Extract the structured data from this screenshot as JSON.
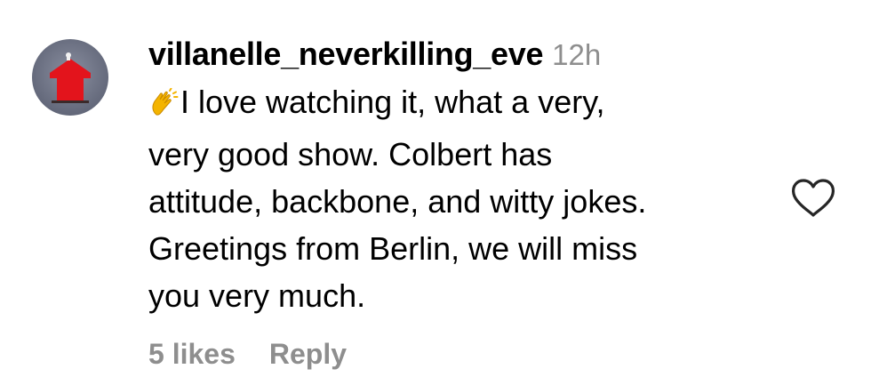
{
  "comment": {
    "username": "villanelle_neverkilling_eve",
    "timestamp": "12h",
    "text_lines": [
      "I love watching it, what a very,",
      "very good show. Colbert has",
      "attitude, backbone, and witty jokes.",
      "Greetings from Berlin, we will miss",
      "you very much."
    ],
    "leading_emoji": "clapping-hands",
    "likes_label": "5 likes",
    "reply_label": "Reply"
  },
  "icons": {
    "like": "heart-outline-icon",
    "avatar": "red-doghouse-avatar"
  },
  "colors": {
    "text": "#000000",
    "secondary_text": "#8e8e8e",
    "avatar_bg": "#6f7486",
    "avatar_house": "#e3141c"
  }
}
